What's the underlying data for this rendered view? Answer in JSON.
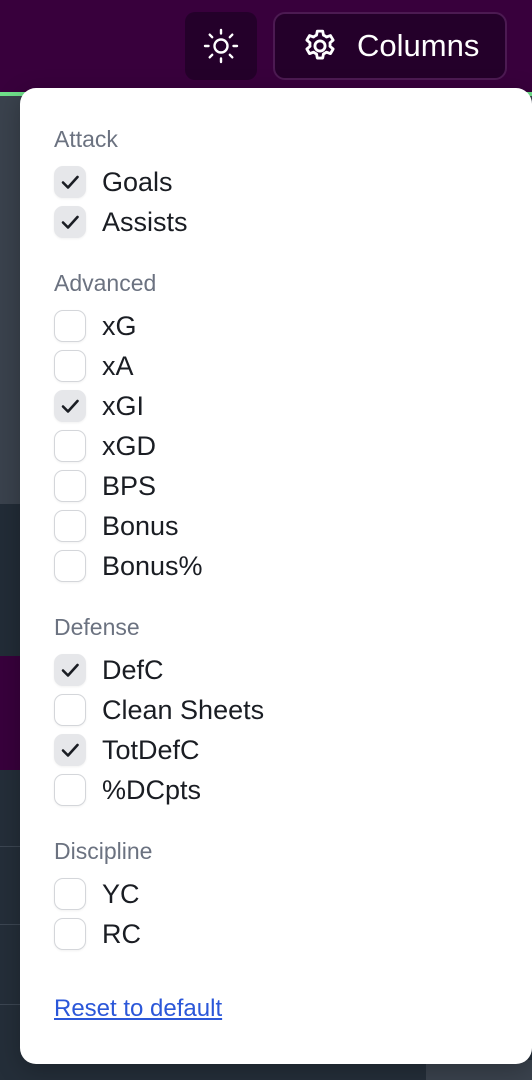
{
  "header": {
    "theme_toggle_icon": "sun-icon",
    "columns_button": {
      "icon": "gear-icon",
      "label": "Columns"
    }
  },
  "dropdown": {
    "groups": [
      {
        "title": "Attack",
        "options": [
          {
            "label": "Goals",
            "checked": true
          },
          {
            "label": "Assists",
            "checked": true
          }
        ]
      },
      {
        "title": "Advanced",
        "options": [
          {
            "label": "xG",
            "checked": false
          },
          {
            "label": "xA",
            "checked": false
          },
          {
            "label": "xGI",
            "checked": true
          },
          {
            "label": "xGD",
            "checked": false
          },
          {
            "label": "BPS",
            "checked": false
          },
          {
            "label": "Bonus",
            "checked": false
          },
          {
            "label": "Bonus%",
            "checked": false
          }
        ]
      },
      {
        "title": "Defense",
        "options": [
          {
            "label": "DefC",
            "checked": true
          },
          {
            "label": "Clean Sheets",
            "checked": false
          },
          {
            "label": "TotDefC",
            "checked": true
          },
          {
            "label": "%DCpts",
            "checked": false
          }
        ]
      },
      {
        "title": "Discipline",
        "options": [
          {
            "label": "YC",
            "checked": false
          },
          {
            "label": "RC",
            "checked": false
          }
        ]
      }
    ],
    "reset_label": "Reset to default"
  },
  "colors": {
    "brand_purple": "#38003c",
    "accent_green": "#6fe08a",
    "link_blue": "#2b57d9"
  }
}
